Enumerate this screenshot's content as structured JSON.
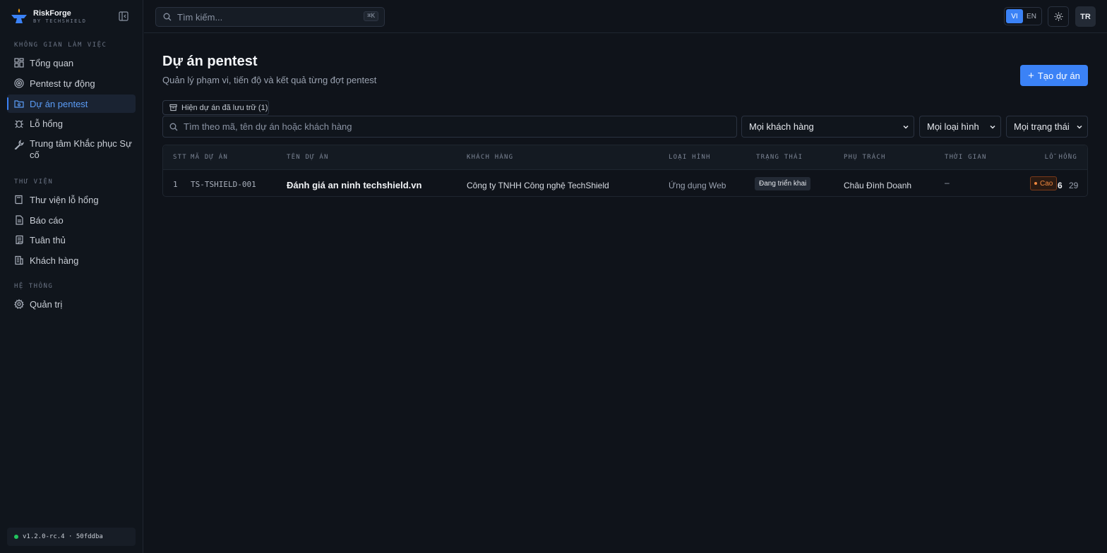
{
  "brand": {
    "name": "RiskForge",
    "sub": "BY TECHSHIELD"
  },
  "sidebar": {
    "sections": [
      {
        "label": "KHÔNG GIAN LÀM VIỆC"
      },
      {
        "label": "THƯ VIỆN"
      },
      {
        "label": "HỆ THỐNG"
      }
    ],
    "items": [
      {
        "label": "Tổng quan",
        "icon": "dashboard-icon"
      },
      {
        "label": "Pentest tự động",
        "icon": "target-icon"
      },
      {
        "label": "Dự án pentest",
        "icon": "folder-icon",
        "active": true
      },
      {
        "label": "Lỗ hổng",
        "icon": "bug-icon"
      },
      {
        "label": "Trung tâm Khắc phục Sự cố",
        "icon": "wrench-icon"
      },
      {
        "label": "Thư viện lỗ hổng",
        "icon": "book-icon"
      },
      {
        "label": "Báo cáo",
        "icon": "document-icon"
      },
      {
        "label": "Tuân thủ",
        "icon": "scroll-icon"
      },
      {
        "label": "Khách hàng",
        "icon": "building-icon"
      },
      {
        "label": "Quản trị",
        "icon": "gear-icon"
      }
    ],
    "version": "v1.2.0-rc.4 · 50fddba"
  },
  "topbar": {
    "search_placeholder": "Tìm kiếm...",
    "shortcut": "⌘K",
    "lang_vi": "VI",
    "lang_en": "EN",
    "avatar": "TR"
  },
  "main": {
    "title": "Dự án pentest",
    "subtitle": "Quản lý phạm vi, tiến độ và kết quả từng đợt pentest",
    "create_label": "Tạo dự án",
    "archived_label": "Hiện dự án đã lưu trữ (1)",
    "search_placeholder": "Tìm theo mã, tên dự án hoặc khách hàng",
    "filters": {
      "customer": "Mọi khách hàng",
      "type": "Mọi loại hình",
      "status": "Mọi trạng thái"
    },
    "columns": [
      "STT",
      "MÃ DỰ ÁN",
      "TÊN DỰ ÁN",
      "KHÁCH HÀNG",
      "LOẠI HÌNH",
      "TRẠNG THÁI",
      "PHỤ TRÁCH",
      "THỜI GIAN",
      "LỖ HỔNG"
    ],
    "rows": [
      {
        "stt": "1",
        "code": "TS-TSHIELD-001",
        "name": "Đánh giá an ninh techshield.vn",
        "customer": "Công ty TNHH Công nghệ TechShield",
        "type": "Ứng dụng Web",
        "status": "Đang triển khai",
        "owner": "Châu Đình Doanh",
        "time": "–",
        "severity": "Cao",
        "severity_count": "6",
        "total": "29"
      }
    ]
  },
  "colors": {
    "accent": "#3b82f6",
    "high": "#f0883e",
    "online": "#22c55e"
  }
}
